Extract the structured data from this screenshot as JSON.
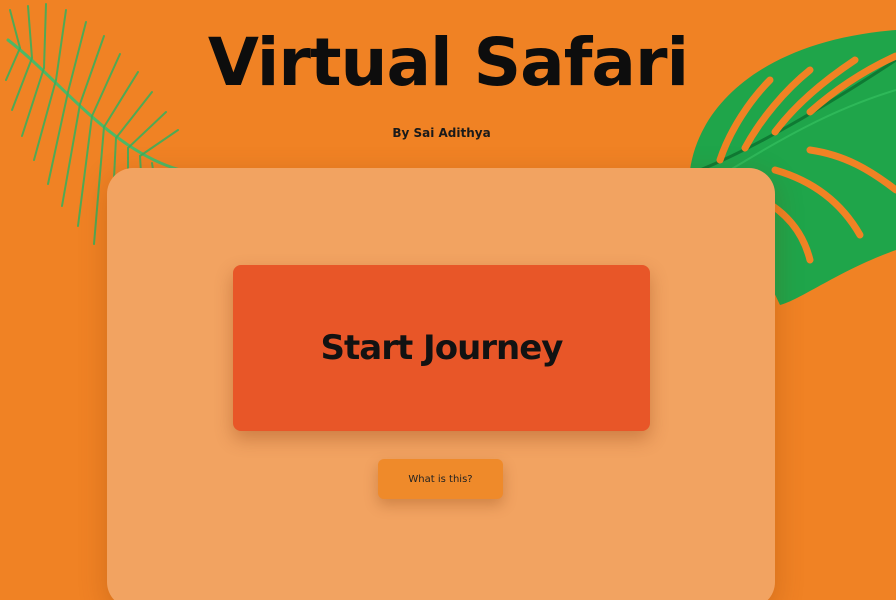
{
  "header": {
    "title": "Virtual Safari",
    "byline": "By Sai Adithya"
  },
  "card": {
    "start_label": "Start Journey",
    "info_label": "What is this?"
  },
  "colors": {
    "background": "#f08224",
    "card": "#f2a361",
    "start_button": "#e85628",
    "info_button": "#ef8a2a",
    "leaf_green": "#1fa54a"
  },
  "icons": {
    "left_decoration": "palm-leaf-icon",
    "right_decoration": "monstera-leaf-icon"
  }
}
